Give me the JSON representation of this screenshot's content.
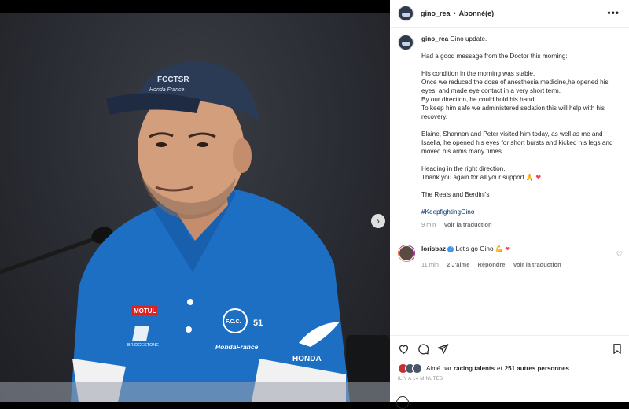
{
  "post": {
    "username": "gino_rea",
    "follow_status": "Abonné(e)",
    "header_separator": "•",
    "more_icon": "more-horizontal-icon"
  },
  "photo": {
    "cap_text_top": "FCCTSR",
    "cap_text_bottom": "Honda France",
    "shirt_logo_motul": "MOTUL",
    "shirt_logo_bridgestone": "BRIDGESTONE",
    "shirt_logo_fcc": "F.C.C.",
    "shirt_logo_number": "51",
    "shirt_logo_hondafrance": "HondaFrance",
    "shirt_logo_honda": "HONDA",
    "next_icon": "chevron-right-icon",
    "carousel_count": 5,
    "carousel_active": 1
  },
  "caption": {
    "username": "gino_rea",
    "first_line": "Gino update.",
    "p1": "Had a good message from the Doctor this morning:",
    "p2_lines": [
      "His condition in the morning was stable.",
      "Once we reduced the dose of anesthesia medicine,he opened his eyes, and made eye contact in a very short term.",
      "By our direction, he could hold his hand.",
      "To keep him safe we administered sedation this will help with his recovery."
    ],
    "p3": "Elaine, Shannon and Peter visited him today, as well as me and Isaella, he opened his eyes for short bursts and kicked his legs and moved his arms many times.",
    "p4_line1": "Heading in the right direction.",
    "p4_line2": "Thank you again for all your support",
    "p4_emojis": "🙏 ❤",
    "signoff": "The Rea's and Berdini's",
    "hashtag": "#KeepfightingGino",
    "time": "9 min",
    "translate": "Voir la traduction"
  },
  "comment": {
    "username": "lorisbaz",
    "verified_icon": "verified-badge-icon",
    "text": "Let's go Gino",
    "emojis": "💪 ❤",
    "time": "11 min",
    "likes": "2 J'aime",
    "reply": "Répondre",
    "translate": "Voir la traduction",
    "like_icon": "heart-outline-icon"
  },
  "actions": {
    "like_icon": "heart-outline-icon",
    "comment_icon": "comment-bubble-icon",
    "share_icon": "paper-plane-icon",
    "save_icon": "bookmark-icon"
  },
  "likes": {
    "prefix": "Aimé par",
    "user": "racing.talents",
    "connector": "et",
    "others": "251 autres personnes"
  },
  "timestamp": "IL Y A 14 MINUTES",
  "colors": {
    "hashtag": "#00376b",
    "heart": "#ed4956",
    "verified": "#3897f0",
    "shirt_blue": "#1d6fc4",
    "cap_navy": "#2b3a55"
  }
}
